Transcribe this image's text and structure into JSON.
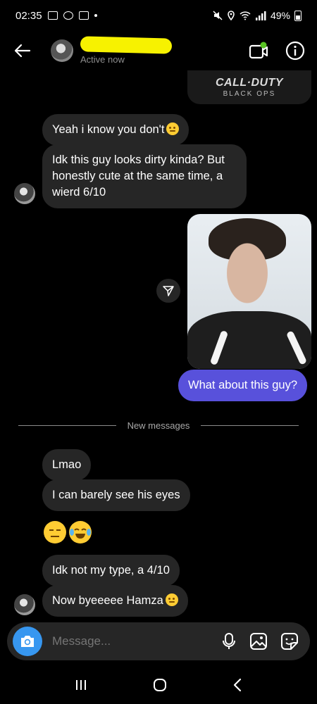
{
  "status_bar": {
    "time": "02:35",
    "battery": "49%"
  },
  "header": {
    "contact_name": "",
    "active_status": "Active now"
  },
  "shared_post": {
    "title": "CALL·DUTY",
    "subtitle": "BLACK OPS"
  },
  "messages": {
    "m1": "Yeah i know you don't",
    "m2": "Idk this guy looks dirty kinda? But honestly cute at the same time, a wierd 6/10",
    "m3": "What about this guy?",
    "divider": "New messages",
    "m4": "Lmao",
    "m5": "I can barely see his eyes",
    "m6": "Idk not my type, a 4/10",
    "m7": "Now byeeeee Hamza"
  },
  "composer": {
    "placeholder": "Message..."
  },
  "colors": {
    "background": "#000000",
    "incoming_bubble": "#262626",
    "outgoing_bubble": "#5851db",
    "camera_button": "#3797f0",
    "name_highlight": "#f7f200"
  }
}
